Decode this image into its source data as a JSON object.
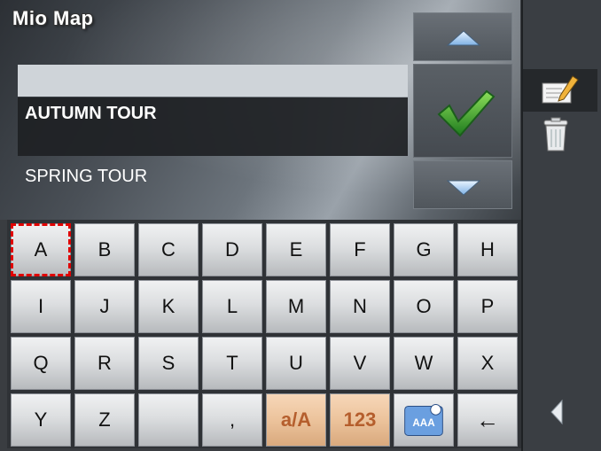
{
  "app": {
    "title": "Mio Map"
  },
  "list": {
    "items": [
      "",
      "AUTUMN TOUR",
      "SPRING TOUR"
    ],
    "selected_index": 1
  },
  "keyboard": {
    "rows": [
      [
        "A",
        "B",
        "C",
        "D",
        "E",
        "F",
        "G",
        "H"
      ],
      [
        "I",
        "J",
        "K",
        "L",
        "M",
        "N",
        "O",
        "P"
      ],
      [
        "Q",
        "R",
        "S",
        "T",
        "U",
        "V",
        "W",
        "X"
      ],
      [
        "Y",
        "Z",
        "",
        ",",
        "a/A",
        "123",
        "AAA-icon",
        "←"
      ]
    ],
    "focused_key": "A"
  },
  "icons": [
    "up-arrow-icon",
    "checkmark-icon",
    "down-arrow-icon",
    "edit-note-icon",
    "trash-icon",
    "back-arrow-icon",
    "keyboard-language-icon"
  ],
  "colors": {
    "focus_outline": "#e00000",
    "check_green": "#2f9b2f",
    "orange_keys": "#ecc39c"
  }
}
